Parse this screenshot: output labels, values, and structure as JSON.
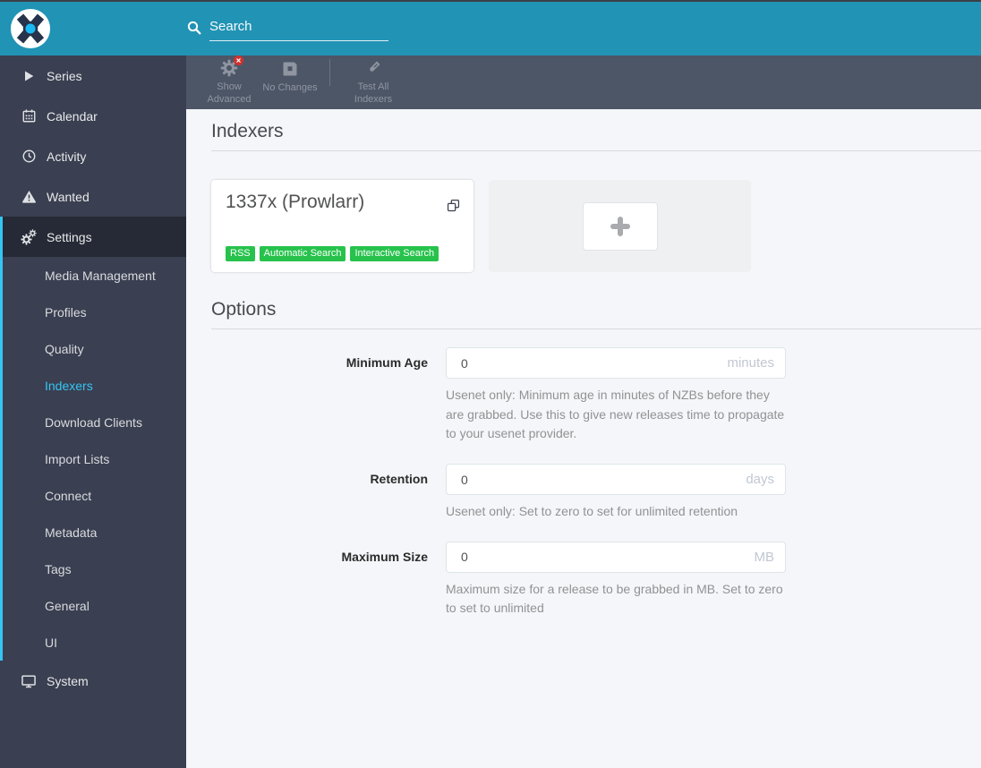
{
  "colors": {
    "header_teal": "#2193b5",
    "toolbar_slate": "#4d5667",
    "sidebar_dark": "#3a3f51",
    "accent_cyan": "#35c5f4",
    "success_green": "#27c24c",
    "danger_red": "#d0312d"
  },
  "header": {
    "logo": "sonarr-logo",
    "search_placeholder": "Search",
    "search_value": ""
  },
  "toolbar": {
    "items": [
      {
        "label": "Show Advanced",
        "icon": "gear-x-icon"
      },
      {
        "label": "No Changes",
        "icon": "save-icon"
      },
      {
        "label": "Test All Indexers",
        "icon": "vial-icon"
      }
    ]
  },
  "sidebar": {
    "items": [
      {
        "label": "Series",
        "icon": "play-icon",
        "active": false
      },
      {
        "label": "Calendar",
        "icon": "calendar-icon",
        "active": false
      },
      {
        "label": "Activity",
        "icon": "clock-icon",
        "active": false
      },
      {
        "label": "Wanted",
        "icon": "warning-triangle-icon",
        "active": false
      },
      {
        "label": "Settings",
        "icon": "cogs-icon",
        "active": true
      },
      {
        "label": "System",
        "icon": "monitor-icon",
        "active": false
      }
    ],
    "settings_children": [
      {
        "label": "Media Management",
        "active": false
      },
      {
        "label": "Profiles",
        "active": false
      },
      {
        "label": "Quality",
        "active": false
      },
      {
        "label": "Indexers",
        "active": true
      },
      {
        "label": "Download Clients",
        "active": false
      },
      {
        "label": "Import Lists",
        "active": false
      },
      {
        "label": "Connect",
        "active": false
      },
      {
        "label": "Metadata",
        "active": false
      },
      {
        "label": "Tags",
        "active": false
      },
      {
        "label": "General",
        "active": false
      },
      {
        "label": "UI",
        "active": false
      }
    ]
  },
  "page": {
    "title": "Indexers",
    "indexer_card": {
      "name": "1337x (Prowlarr)",
      "clone_icon": "clone-icon",
      "tags": [
        "RSS",
        "Automatic Search",
        "Interactive Search"
      ]
    },
    "add_card_icon": "plus-icon",
    "options": {
      "title": "Options",
      "fields": [
        {
          "label": "Minimum Age",
          "value": "0",
          "unit": "minutes",
          "help": "Usenet only: Minimum age in minutes of NZBs before they are grabbed. Use this to give new releases time to propagate to your usenet provider."
        },
        {
          "label": "Retention",
          "value": "0",
          "unit": "days",
          "help": "Usenet only: Set to zero to set for unlimited retention"
        },
        {
          "label": "Maximum Size",
          "value": "0",
          "unit": "MB",
          "help": "Maximum size for a release to be grabbed in MB. Set to zero to set to unlimited"
        }
      ]
    }
  }
}
